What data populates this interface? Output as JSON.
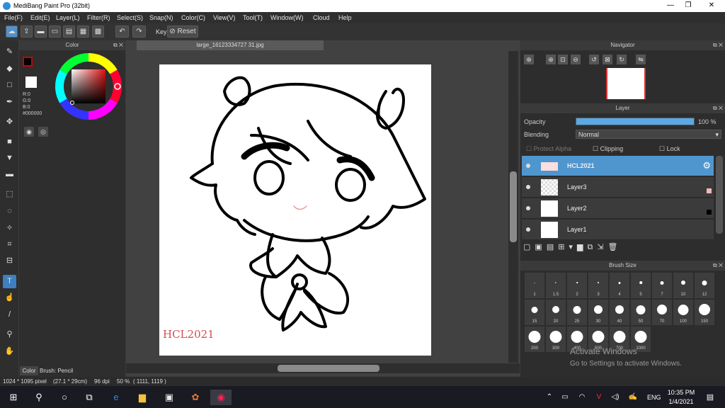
{
  "window": {
    "title": "MediBang Paint Pro (32bit)",
    "min": "—",
    "max": "❐",
    "close": "✕"
  },
  "menu": [
    "File(F)",
    "Edit(E)",
    "Layer(L)",
    "Filter(R)",
    "Select(S)",
    "Snap(N)",
    "Color(C)",
    "View(V)",
    "Tool(T)",
    "Window(W)",
    "Cloud",
    "Help"
  ],
  "toolbar": {
    "key_label": "Key",
    "reset_label": "Reset"
  },
  "color_panel": {
    "title": "Color",
    "r": "R:0",
    "g": "G:0",
    "b": "B:0",
    "hex": "#000000",
    "tab_color": "Color",
    "tab_brush": "Brush: Pencil"
  },
  "document": {
    "tab": "large_16123334727 31.jpg",
    "watermark": "HCL2021"
  },
  "navigator": {
    "title": "Navigator"
  },
  "layer_panel": {
    "title": "Layer",
    "opacity_label": "Opacity",
    "opacity_value": "100 %",
    "opacity": 1.0,
    "blending_label": "Blending",
    "blending_value": "Normal",
    "protect_alpha": "Protect Alpha",
    "clipping": "Clipping",
    "lock": "Lock",
    "layers": [
      {
        "name": "HCL2021",
        "selected": true
      },
      {
        "name": "Layer3",
        "selected": false
      },
      {
        "name": "Layer2",
        "selected": false
      },
      {
        "name": "Layer1",
        "selected": false
      }
    ]
  },
  "brush_panel": {
    "title": "Brush Size",
    "sizes": [
      "1",
      "1.5",
      "2",
      "3",
      "4",
      "5",
      "7",
      "10",
      "12",
      "15",
      "20",
      "25",
      "30",
      "40",
      "50",
      "70",
      "100",
      "150",
      "200",
      "300",
      "400",
      "500",
      "700",
      "1000"
    ]
  },
  "status": {
    "size": "1024 * 1095 pixel",
    "cm": "(27.1 * 29cm)",
    "dpi": "96 dpi",
    "zoom": "50 %",
    "coords": "( 1111, 1119 )"
  },
  "activation": {
    "line1": "Activate Windows",
    "line2": "Go to Settings to activate Windows."
  },
  "taskbar": {
    "lang": "ENG",
    "time": "10:35 PM",
    "date": "1/4/2021"
  },
  "colors": {
    "accent": "#4f96cf",
    "opacity_bar": "#5aa9e6"
  }
}
